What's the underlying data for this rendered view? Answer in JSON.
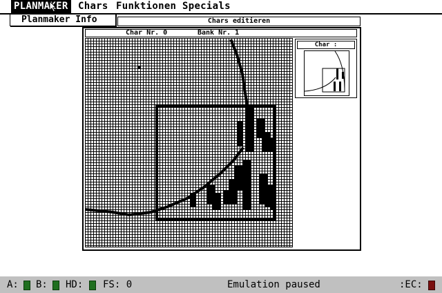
{
  "menubar": {
    "items": [
      "PLANMAKER",
      "Chars",
      "Funktionen",
      "Specials"
    ]
  },
  "dropdown": {
    "items": [
      "Planmaker Info"
    ]
  },
  "editor": {
    "title": "Chars editieren",
    "char_label": "Char Nr. 0",
    "bank_label": "Bank Nr. 1",
    "preview_label": "Char :"
  },
  "status": {
    "drive_a": "A:",
    "drive_b": "B:",
    "drive_hd": "HD:",
    "fs": "FS: 0",
    "message": "Emulation paused",
    "ec": ":EC:"
  },
  "colors": {
    "led_on": "#1f6f1f",
    "led_ec": "#7a1010",
    "statusbar": "#c0c0c0"
  },
  "icons": {
    "cursor": "arrow-pointer-icon"
  }
}
